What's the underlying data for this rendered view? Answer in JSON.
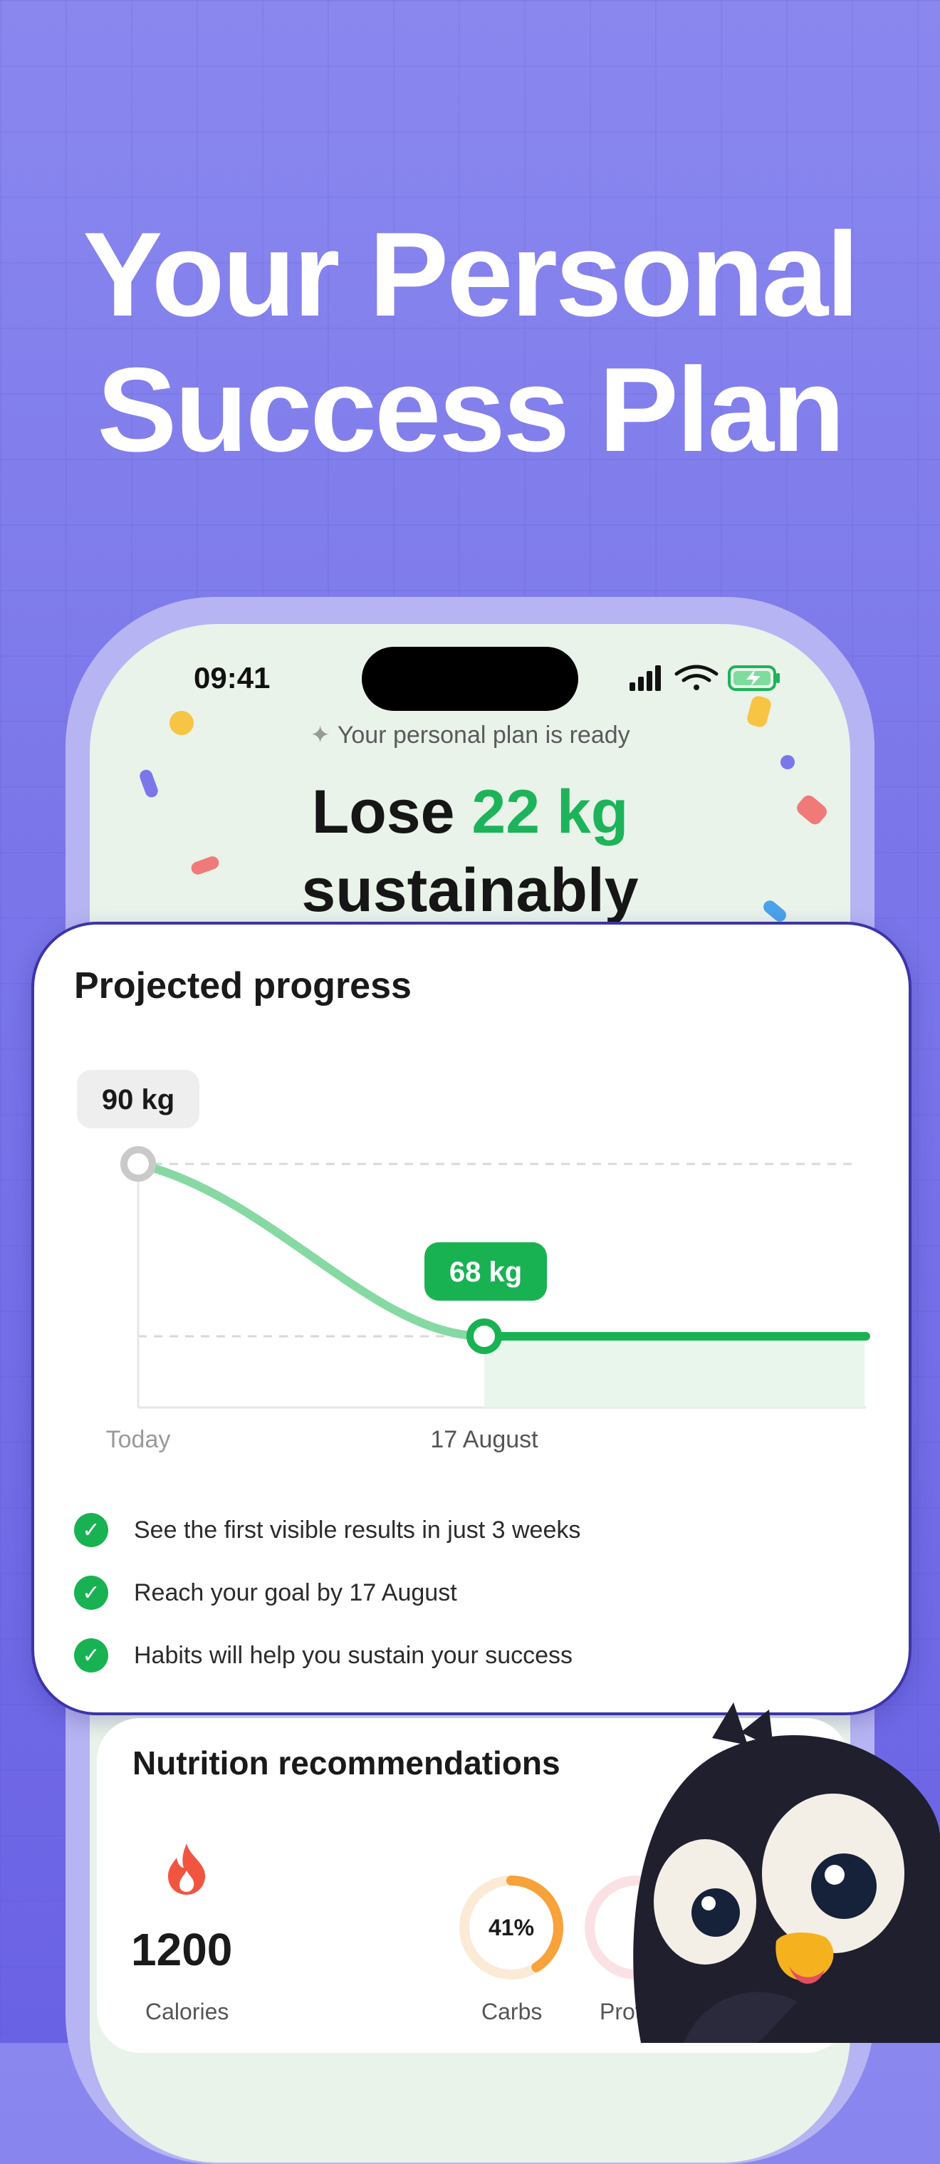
{
  "headline": {
    "line1": "Your Personal",
    "line2": "Success Plan"
  },
  "status_bar": {
    "time": "09:41"
  },
  "plan": {
    "ready_text": "Your personal plan is ready",
    "title_prefix": "Lose",
    "title_amount": "22 kg",
    "title_suffix": "sustainably"
  },
  "progress_card": {
    "title": "Projected progress",
    "start_label": "90 kg",
    "goal_label": "68 kg",
    "x_labels": [
      "Today",
      "17 August"
    ],
    "bullets": [
      "See the first visible results in just 3 weeks",
      "Reach your goal by 17 August",
      "Habits will help you sustain your success"
    ]
  },
  "chart_data": {
    "type": "line",
    "title": "Projected progress",
    "x": [
      "Today",
      "17 August"
    ],
    "series": [
      {
        "values": [
          90,
          68
        ]
      }
    ],
    "point_labels": [
      "90 kg",
      "68 kg"
    ]
  },
  "nutrition": {
    "title": "Nutrition recommendations",
    "calories_value": "1200",
    "calories_label": "Calories",
    "carbs_percent": "41%",
    "carbs_fraction": 0.41,
    "carbs_label": "Carbs",
    "protein_label_partial": "Prot"
  },
  "colors": {
    "accent_green": "#1db35a",
    "background": "#7b77ea",
    "carbs_orange": "#f7a23a"
  }
}
